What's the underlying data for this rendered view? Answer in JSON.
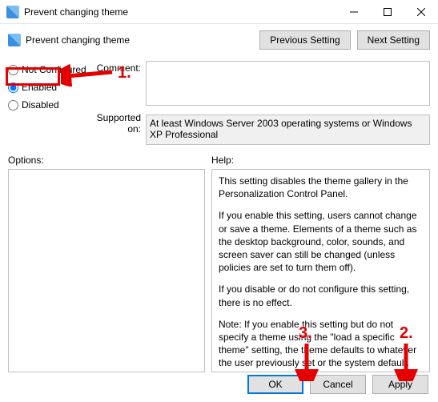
{
  "title": "Prevent changing theme",
  "heading": "Prevent changing theme",
  "nav": {
    "previous": "Previous Setting",
    "next": "Next Setting"
  },
  "state": {
    "not_configured": "Not Configured",
    "enabled": "Enabled",
    "disabled": "Disabled"
  },
  "labels": {
    "comment": "Comment:",
    "supported": "Supported on:",
    "options": "Options:",
    "help": "Help:"
  },
  "comment_value": "",
  "supported_value": "At least Windows Server 2003 operating systems or Windows XP Professional",
  "help_paragraphs": {
    "p1": "This setting disables the theme gallery in the Personalization Control Panel.",
    "p2": "If you enable this setting, users cannot change or save a theme. Elements of a theme such as the desktop background, color, sounds, and screen saver can still be changed (unless policies are set to turn them off).",
    "p3": "If you disable or do not configure this setting, there is no effect.",
    "p4": "Note: If you enable this setting but do not specify a theme using the \"load a specific theme\" setting, the theme defaults to whatever the user previously set or the system default."
  },
  "buttons": {
    "ok": "OK",
    "cancel": "Cancel",
    "apply": "Apply"
  },
  "annotations": {
    "a1": "1.",
    "a2": "2.",
    "a3": "3."
  }
}
